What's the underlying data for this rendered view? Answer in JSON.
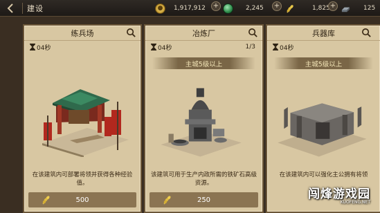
{
  "header": {
    "back_icon": "chevron-left-icon",
    "title": "建设"
  },
  "resources": [
    {
      "name": "gold",
      "icon": "coin-icon",
      "value": "1,917,912"
    },
    {
      "name": "jade",
      "icon": "jade-orb-icon",
      "value": "2,245"
    },
    {
      "name": "grain",
      "icon": "wheat-icon",
      "value": "1,825"
    },
    {
      "name": "iron",
      "icon": "iron-ingot-icon",
      "value": "125"
    }
  ],
  "cards": [
    {
      "name": "练兵场",
      "time": "04秒",
      "count": "",
      "requirement": "",
      "description": "在该建筑内可部署将领并获得各种经验值。",
      "cost": "500"
    },
    {
      "name": "冶炼厂",
      "time": "04秒",
      "count": "1/3",
      "requirement": "主城5级以上",
      "description": "该建筑可用于生产内政所需的铁矿石高级资源。",
      "cost": "250"
    },
    {
      "name": "兵器库",
      "time": "04秒",
      "count": "",
      "requirement": "主城5级以上",
      "description": "在该建筑内可以强化主公拥有将领",
      "cost": ""
    }
  ],
  "watermark": {
    "text": "闯烽游戏园",
    "url": "KUOFENG.NET"
  },
  "colors": {
    "card_bg": "#d8c7a2",
    "card_border": "#6b5638",
    "banner_text": "#f4e6b8",
    "cost_bar": "#8b7452"
  }
}
